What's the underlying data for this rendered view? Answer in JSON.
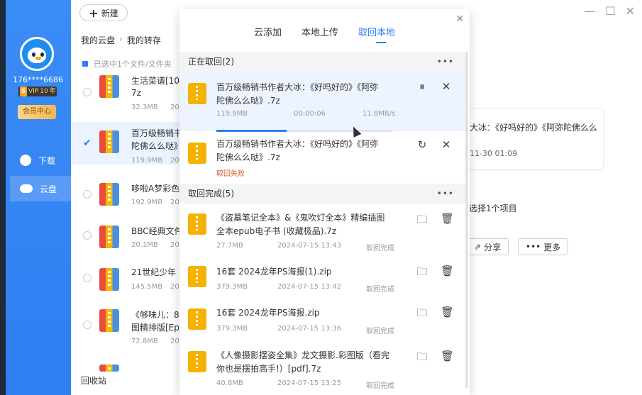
{
  "sidebar": {
    "username": "176****6686",
    "vip_label": "VIP",
    "vip_level": "10",
    "vip_suffix": "年",
    "member_center": "会员中心",
    "nav": [
      {
        "label": "下载",
        "icon": "download-icon"
      },
      {
        "label": "云盘",
        "icon": "cloud-icon"
      }
    ]
  },
  "main": {
    "new_button": "新建",
    "breadcrumb": [
      "我的云盘",
      "我的转存"
    ],
    "selection_info": "已选中1个文件/文件夹",
    "files": [
      {
        "name_line1": "生活菜谱[10",
        "name_line2": "7z",
        "size": "32.3MB",
        "date": "20"
      },
      {
        "name_line1": "百万级畅销书",
        "name_line2": "陀佛么么哒》",
        "size": "119.9MB",
        "date": "20"
      },
      {
        "name_line1": "哆啦A梦彩色",
        "name_line2": "",
        "size": "192.9MB",
        "date": "20"
      },
      {
        "name_line1": "BBC经典文件",
        "name_line2": "",
        "size": "20.1MB",
        "date": "20"
      },
      {
        "name_line1": "21世纪少年",
        "name_line2": "",
        "size": "145.5MB",
        "date": "20"
      },
      {
        "name_line1": "《够味儿：8",
        "name_line2": "图精排版[Ep",
        "size": "72.8MB",
        "date": "20"
      }
    ],
    "recycle": "回收站"
  },
  "details": {
    "title": "大冰：《好吗好的》《阿弥陀佛么么",
    "date": "11-30 01:09",
    "selected_count": "选择1个项目",
    "share": "分享",
    "more": "更多"
  },
  "modal": {
    "tabs": [
      "云添加",
      "本地上传",
      "取回本地"
    ],
    "active_tab": 2,
    "section_running": "正在取回(2)",
    "section_done": "取回完成(5)",
    "more_dots": "•••",
    "running": [
      {
        "line1": "百万级畅销书作者大冰：《好吗好的》《阿弥",
        "line2": "陀佛么么哒》.7z",
        "size": "119.9MB",
        "time": "00:00:06",
        "speed": "11.8MB/s",
        "progress": 0.4
      },
      {
        "line1": "百万级畅销书作者大冰：《好吗好的》《阿弥",
        "line2": "陀佛么么哒》.7z",
        "status": "取回失败"
      }
    ],
    "done": [
      {
        "line1": "《盗墓笔记全本》&《鬼吹灯全本》精编插图",
        "line2": "全本epub电子书 (收藏极品).7z",
        "size": "27.7MB",
        "date": "2024-07-15 13:43",
        "status": "取回完成"
      },
      {
        "line1": "16套 2024龙年PS海报(1).zip",
        "line2": "",
        "size": "379.3MB",
        "date": "2024-07-15 13:42",
        "status": "取回完成"
      },
      {
        "line1": "16套 2024龙年PS海报.zip",
        "line2": "",
        "size": "379.3MB",
        "date": "2024-07-15 13:36",
        "status": "取回完成"
      },
      {
        "line1": "《人像摄影摆姿全集》龙文摄影.彩图版（看完",
        "line2": "你也是摆拍高手!）[pdf].7z",
        "size": "40.8MB",
        "date": "2024-07-15 13:25",
        "status": "取回完成"
      }
    ]
  },
  "colors": {
    "accent": "#2f7ef2",
    "failed": "#e25c2a",
    "folder": "#f5b200"
  }
}
